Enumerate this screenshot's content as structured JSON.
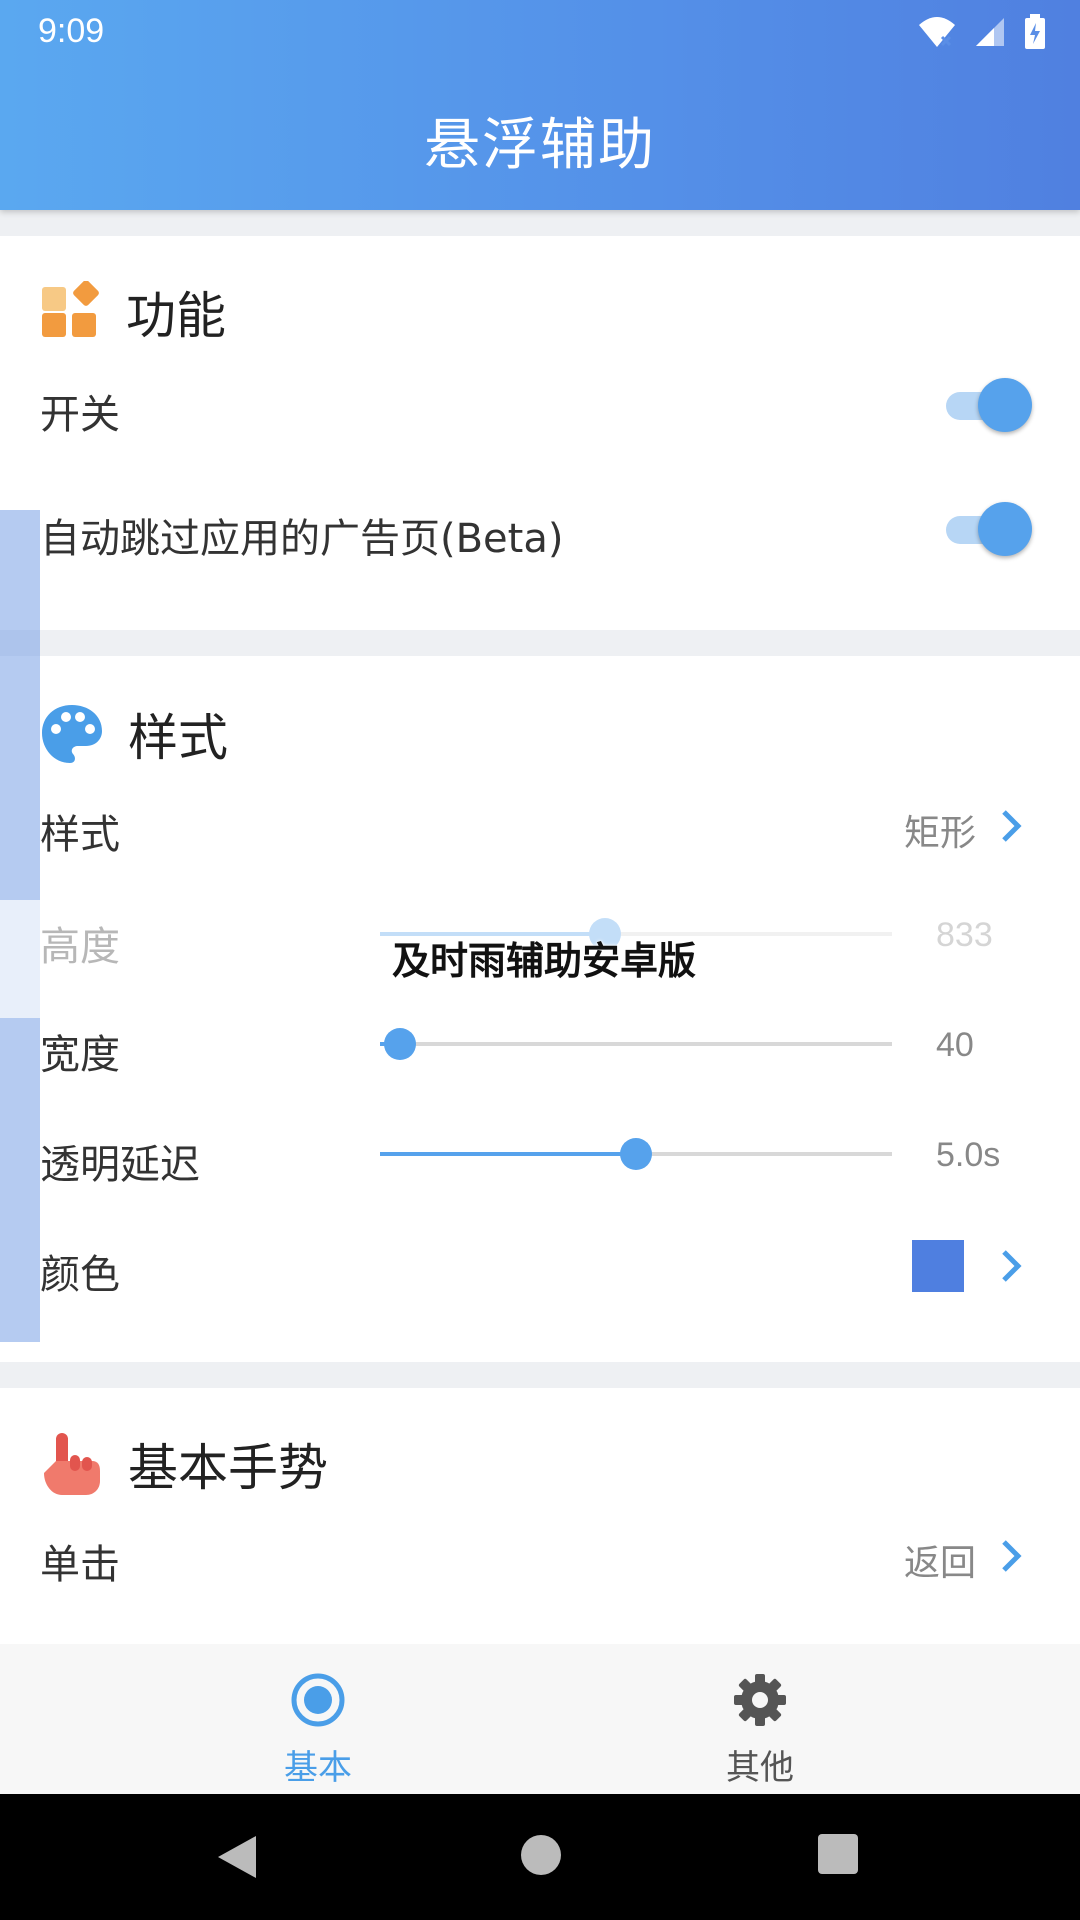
{
  "status_bar": {
    "time": "9:09"
  },
  "app_bar": {
    "title": "悬浮辅助"
  },
  "sections": {
    "function": {
      "title": "功能",
      "rows": [
        {
          "label": "开关",
          "enabled": true
        },
        {
          "label": "自动跳过应用的广告页(Beta)",
          "enabled": true
        }
      ]
    },
    "style": {
      "title": "样式",
      "style_row": {
        "label": "样式",
        "value": "矩形"
      },
      "height_row": {
        "label": "高度",
        "value": "833",
        "fraction": 0.44
      },
      "width_row": {
        "label": "宽度",
        "value": "40",
        "fraction": 0.04
      },
      "fade_row": {
        "label": "透明延迟",
        "value": "5.0s",
        "fraction": 0.5
      },
      "color_row": {
        "label": "颜色",
        "swatch": "#4f7fe0"
      }
    },
    "gesture": {
      "title": "基本手势",
      "tap_row": {
        "label": "单击",
        "value": "返回"
      }
    }
  },
  "watermark": "及时雨辅助安卓版",
  "bottom_nav": {
    "basic": {
      "label": "基本",
      "active": true
    },
    "other": {
      "label": "其他",
      "active": false
    }
  },
  "colors": {
    "accent": "#56a2ec",
    "active_tab": "#4a9ee8",
    "inactive_tab": "#555555"
  }
}
